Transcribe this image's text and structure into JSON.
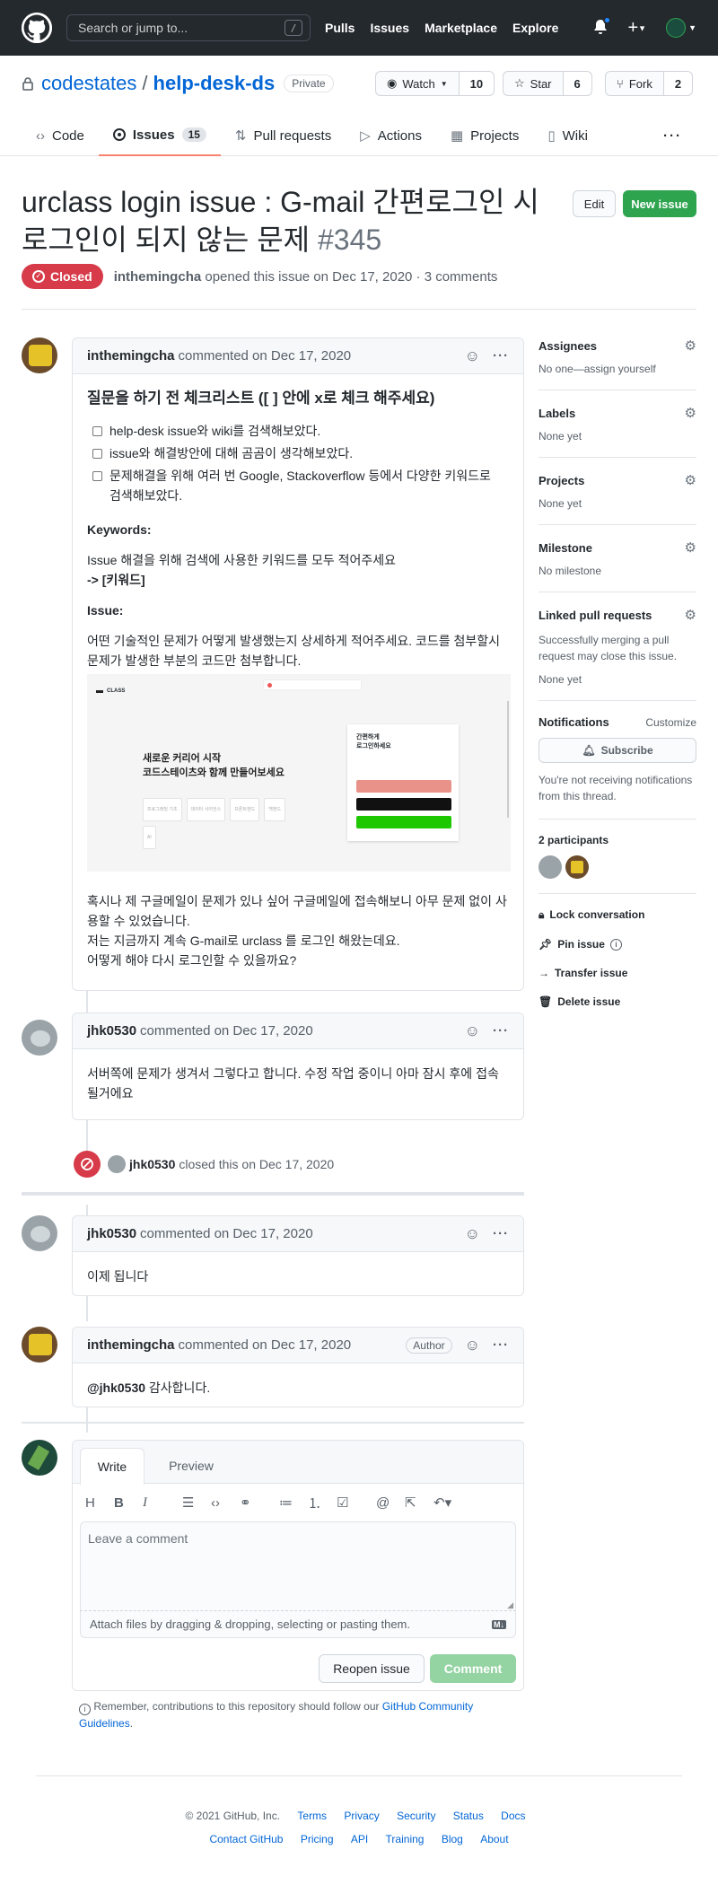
{
  "header": {
    "search_placeholder": "Search or jump to...",
    "slash": "/",
    "nav": [
      "Pulls",
      "Issues",
      "Marketplace",
      "Explore"
    ]
  },
  "repo": {
    "owner": "codestates",
    "name": "help-desk-ds",
    "visibility": "Private",
    "watch": {
      "label": "Watch",
      "count": "10"
    },
    "star": {
      "label": "Star",
      "count": "6"
    },
    "fork": {
      "label": "Fork",
      "count": "2"
    }
  },
  "tabs": [
    {
      "label": "Code"
    },
    {
      "label": "Issues",
      "count": "15"
    },
    {
      "label": "Pull requests"
    },
    {
      "label": "Actions"
    },
    {
      "label": "Projects"
    },
    {
      "label": "Wiki"
    }
  ],
  "issue": {
    "title": "urclass login issue : G-mail 간편로그인 시 로그인이 되지 않는 문제",
    "number": "#345",
    "status": "Closed",
    "author": "inthemingcha",
    "opened_text": "opened this issue on Dec 17, 2020 · 3 comments",
    "edit_label": "Edit",
    "new_label": "New issue"
  },
  "comment1": {
    "author": "inthemingcha",
    "when": "commented on Dec 17, 2020",
    "h": "질문을 하기 전 체크리스트 ([ ] 안에 x로 체크 해주세요)",
    "checks": [
      "help-desk issue와 wiki를 검색해보았다.",
      "issue와 해결방안에 대해 곰곰이 생각해보았다.",
      "문제해결을 위해 여러 번 Google, Stackoverflow 등에서 다양한 키워드로 검색해보았다."
    ],
    "kw_h": "Keywords:",
    "kw_text": "Issue 해결을 위해 검색에 사용한 키워드를 모두 적어주세요",
    "kw_val": "-> [키워드]",
    "issue_h": "Issue:",
    "issue_text": "어떤 기술적인 문제가 어떻게 발생했는지 상세하게 적어주세요. 코드를 첨부할시 문제가 발생한 부분의 코드만 첨부합니다.",
    "shot": {
      "brand": "CLASS",
      "hero1": "새로운 커리어 시작",
      "hero2": "코드스테이츠와 함께 만들어보세요",
      "login1": "간편하게",
      "login2": "로그인하세요",
      "tags": [
        "프로그래밍 기초",
        "데이터 사이언스",
        "프론트엔드",
        "백엔드",
        "AI"
      ]
    },
    "p1": "혹시나 제 구글메일이 문제가 있나 싶어 구글메일에 접속해보니 아무 문제 없이 사용할 수 있었습니다.",
    "p2": "저는 지금까지 계속 G-mail로 urclass 를 로그인 해왔는데요.",
    "p3": "어떻게 해야 다시 로그인할 수 있을까요?"
  },
  "comment2": {
    "author": "jhk0530",
    "when": "commented on Dec 17, 2020",
    "text": "서버쪽에 문제가 생겨서 그렇다고 합니다. 수정 작업 중이니 아마 잠시 후에 접속 될거에요"
  },
  "event": {
    "actor": "jhk0530",
    "text": "closed this on Dec 17, 2020"
  },
  "comment3": {
    "author": "jhk0530",
    "when": "commented on Dec 17, 2020",
    "text": "이제 됩니다"
  },
  "comment4": {
    "author": "inthemingcha",
    "when": "commented on Dec 17, 2020",
    "badge": "Author",
    "mention": "@jhk0530",
    "text": " 감사합니다."
  },
  "editor": {
    "tab_write": "Write",
    "tab_preview": "Preview",
    "placeholder": "Leave a comment",
    "attach": "Attach files by dragging & dropping, selecting or pasting them.",
    "md": "M↓",
    "reopen": "Reopen issue",
    "comment": "Comment",
    "note_pre": "Remember, contributions to this repository should follow our ",
    "note_link": "GitHub Community Guidelines",
    "note_post": "."
  },
  "sidebar": {
    "assignees_h": "Assignees",
    "assignees_v": "No one—assign yourself",
    "labels_h": "Labels",
    "labels_v": "None yet",
    "projects_h": "Projects",
    "projects_v": "None yet",
    "milestone_h": "Milestone",
    "milestone_v": "No milestone",
    "linked_h": "Linked pull requests",
    "linked_desc": "Successfully merging a pull request may close this issue.",
    "linked_v": "None yet",
    "notif_h": "Notifications",
    "customize": "Customize",
    "subscribe": "Subscribe",
    "notif_desc": "You're not receiving notifications from this thread.",
    "participants": "2 participants",
    "lock": "Lock conversation",
    "pin": "Pin issue",
    "transfer": "Transfer issue",
    "delete": "Delete issue"
  },
  "footer": {
    "copy": "© 2021 GitHub, Inc.",
    "row1": [
      "Terms",
      "Privacy",
      "Security",
      "Status",
      "Docs"
    ],
    "row2": [
      "Contact GitHub",
      "Pricing",
      "API",
      "Training",
      "Blog",
      "About"
    ]
  }
}
